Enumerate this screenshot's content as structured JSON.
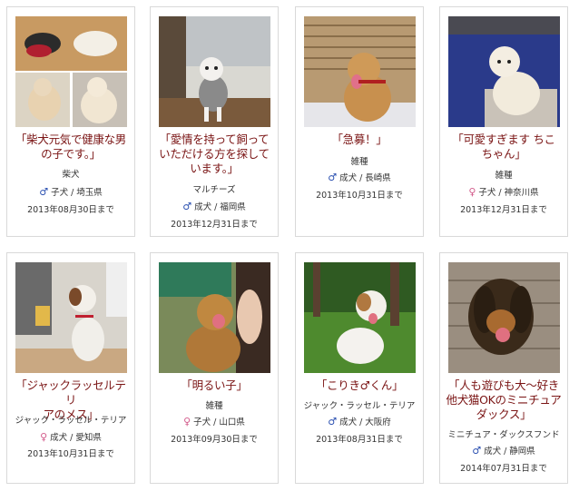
{
  "listings": [
    {
      "title": "「柴犬元気で健康な男の子です。」",
      "title_lines": [
        "「柴犬元気で健康な男",
        "の子です。」"
      ],
      "breed": "柴犬",
      "gender": "male",
      "gender_symbol": "♂",
      "age": "子犬",
      "location": "埼玉県",
      "deadline": "2013年08月30日まで"
    },
    {
      "title": "「愛情を持って飼っていただける方を探しています。」",
      "title_lines": [
        "「愛情を持って飼って",
        "いただける方を探して",
        "います。」"
      ],
      "breed": "マルチーズ",
      "gender": "male",
      "gender_symbol": "♂",
      "age": "成犬",
      "location": "福岡県",
      "deadline": "2013年12月31日まで"
    },
    {
      "title": "「急募！」",
      "title_lines": [
        "「急募！」"
      ],
      "breed": "雑種",
      "gender": "male",
      "gender_symbol": "♂",
      "age": "成犬",
      "location": "長崎県",
      "deadline": "2013年10月31日まで"
    },
    {
      "title": "「可愛すぎます ちこちゃん」",
      "title_lines": [
        "「可愛すぎます ちこ",
        "ちゃん」"
      ],
      "breed": "雑種",
      "gender": "female",
      "gender_symbol": "♀",
      "age": "子犬",
      "location": "神奈川県",
      "deadline": "2013年12月31日まで"
    },
    {
      "title": "「ジャックラッセルテリアのメス」",
      "title_lines": [
        "「ジャックラッセルテリ",
        "アのメス」"
      ],
      "breed": "ジャック・ラッセル・テリア",
      "gender": "female",
      "gender_symbol": "♀",
      "age": "成犬",
      "location": "愛知県",
      "deadline": "2013年10月31日まで"
    },
    {
      "title": "「明るい子」",
      "title_lines": [
        "「明るい子」"
      ],
      "breed": "雑種",
      "gender": "female",
      "gender_symbol": "♀",
      "age": "子犬",
      "location": "山口県",
      "deadline": "2013年09月30日まで"
    },
    {
      "title": "「こりき♂くん」",
      "title_lines": [
        "「こりき♂くん」"
      ],
      "breed": "ジャック・ラッセル・テリア",
      "gender": "male",
      "gender_symbol": "♂",
      "age": "成犬",
      "location": "大阪府",
      "deadline": "2013年08月31日まで"
    },
    {
      "title": "「人も遊びも大～好き他犬猫OKのミニチュアダックス」",
      "title_lines": [
        "「人も遊びも大～好き",
        "他犬猫OKのミニチュア",
        "ダックス」"
      ],
      "breed": "ミニチュア・ダックスフンド",
      "gender": "male",
      "gender_symbol": "♂",
      "age": "成犬",
      "location": "静岡県",
      "deadline": "2014年07月31日まで"
    }
  ],
  "separator": "/",
  "colors": {
    "title": "#7a1414",
    "male": "#2a4fb0",
    "female": "#d25a8a",
    "card_border": "#d9d9d9"
  }
}
